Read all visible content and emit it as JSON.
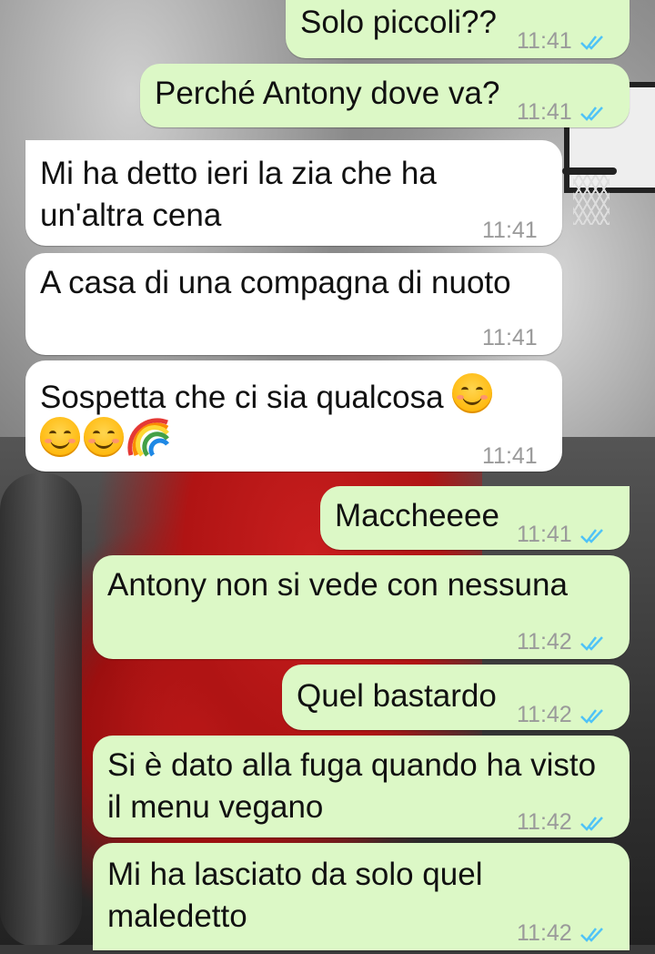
{
  "chat": {
    "messages": [
      {
        "id": "m1",
        "dir": "out",
        "text": "Solo piccoli??",
        "time": "11:41",
        "read": true
      },
      {
        "id": "m2",
        "dir": "out",
        "text": "Perché Antony dove va?",
        "time": "11:41",
        "read": true
      },
      {
        "id": "m3",
        "dir": "in",
        "text": "Mi ha detto ieri la zia che ha\nun'altra cena",
        "time": "11:41"
      },
      {
        "id": "m4",
        "dir": "in",
        "text": "A casa di una compagna di nuoto",
        "time": "11:41"
      },
      {
        "id": "m5",
        "dir": "in",
        "text": "Sospetta che ci sia qualcosa",
        "emoji_line": [
          "smiling-face-icon",
          "smiling-face-icon",
          "rainbow-icon"
        ],
        "time": "11:41"
      },
      {
        "id": "m6",
        "dir": "out",
        "text": "Maccheeee",
        "time": "11:41",
        "read": true
      },
      {
        "id": "m7",
        "dir": "out",
        "text": "Antony non si vede con nessuna",
        "time": "11:42",
        "read": true
      },
      {
        "id": "m8",
        "dir": "out",
        "text": "Quel bastardo",
        "time": "11:42",
        "read": true
      },
      {
        "id": "m9",
        "dir": "out",
        "text": "Si è dato alla fuga quando ha visto\nil menu vegano",
        "time": "11:42",
        "read": true
      },
      {
        "id": "m10",
        "dir": "out",
        "text": "Mi ha lasciato da solo quel\nmaledetto",
        "time": "11:42",
        "read": true
      }
    ]
  },
  "colors": {
    "outgoing_bubble": "#dcf8c6",
    "incoming_bubble": "#ffffff",
    "read_ticks": "#4fc3f7",
    "timestamp": "#9a9a9a"
  }
}
